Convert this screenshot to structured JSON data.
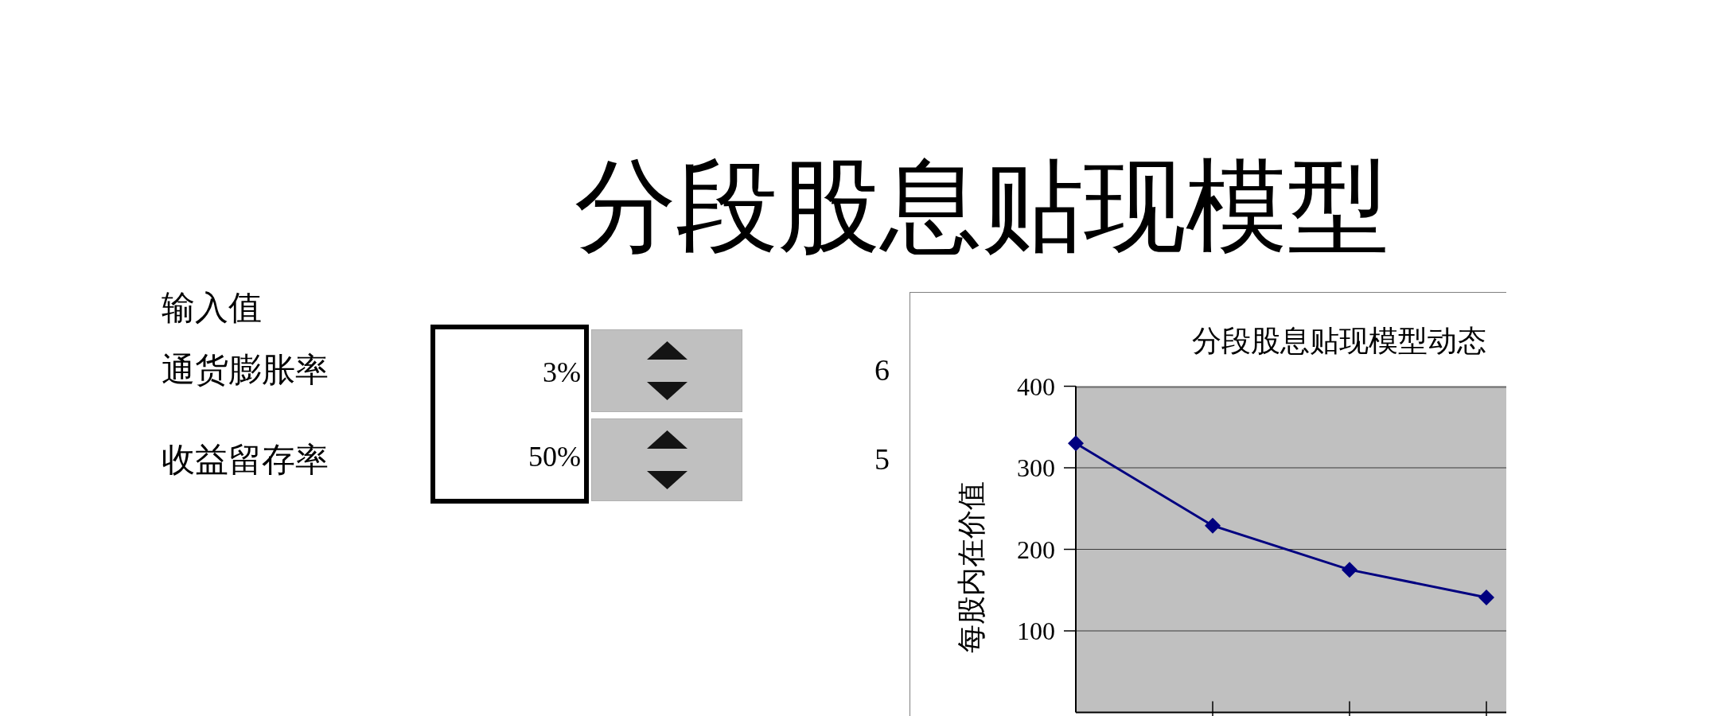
{
  "title": "分段股息贴现模型",
  "inputs": {
    "heading": "输入值",
    "rows": [
      {
        "label": "通货膨胀率",
        "value": "3%",
        "count": "6"
      },
      {
        "label": "收益留存率",
        "value": "50%",
        "count": "5"
      }
    ]
  },
  "chart": {
    "chart_data": {
      "type": "line",
      "title": "分段股息贴现模型动态",
      "ylabel": "每股内在价值",
      "ylim": [
        0,
        400
      ],
      "yticks": [
        100,
        200,
        300,
        400
      ],
      "grid": true,
      "series": [
        {
          "color": "#000080",
          "marker": "diamond",
          "values": [
            330,
            229,
            175,
            141
          ]
        }
      ]
    }
  }
}
